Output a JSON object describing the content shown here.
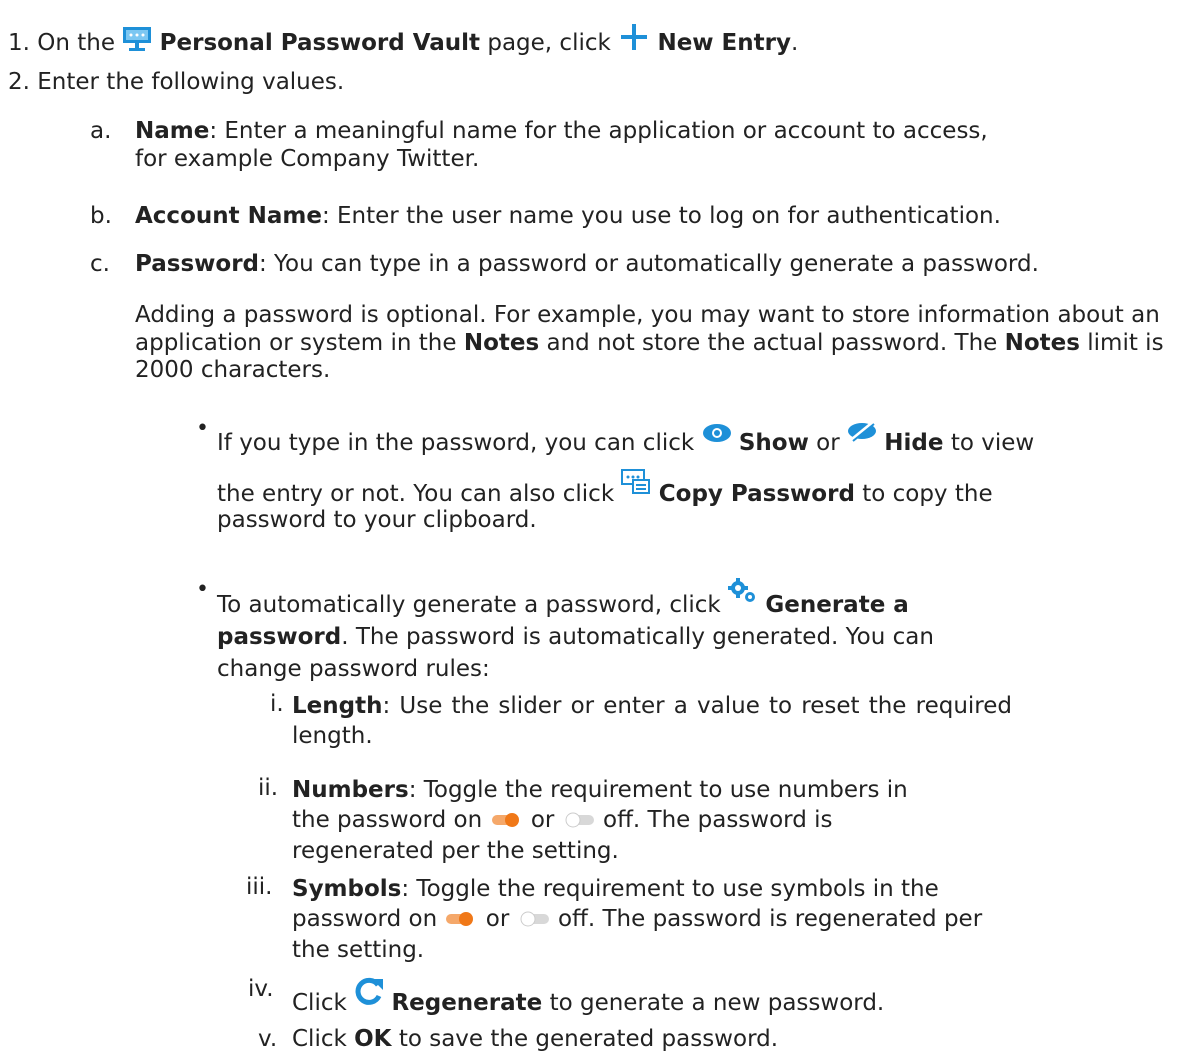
{
  "markers": {
    "s1": "1.",
    "s2": "2.",
    "a": "a.",
    "b": "b.",
    "c": "c.",
    "r1": "i.",
    "r2": "ii.",
    "r3": "iii.",
    "r4": "iv.",
    "r5": "v.",
    "bullet": "•"
  },
  "step1": {
    "t1": "On the",
    "vault": "Personal Password Vault",
    "t2": "page, click",
    "new_entry": "New Entry",
    "t3": "."
  },
  "step2": {
    "text": "Enter the following values."
  },
  "item_a": {
    "label": "Name",
    "text": ": Enter a meaningful name for the application or account to access, for example Company Twitter."
  },
  "item_b": {
    "label": "Account Name",
    "text": ": Enter the user name you use to log on for authentication."
  },
  "item_c": {
    "label": "Password",
    "text": ": You can type in a password or automatically generate a password.",
    "para1": "Adding a password is optional. For example, you may want to store information about an application or system in the",
    "notes1": "Notes",
    "para2": "and not store the actual password. The",
    "notes2": "Notes",
    "para3": "limit is 2000 characters."
  },
  "bullet1": {
    "t1": "If you type in the password, you can click",
    "show": "Show",
    "t2": "or",
    "hide": "Hide",
    "t3": "to view",
    "t4": "the entry or not. You can also click",
    "copy": "Copy Password",
    "t5": "to copy the",
    "t6": "password to your clipboard."
  },
  "bullet2": {
    "t1": "To automatically generate a password, click",
    "gen": "Generate a password",
    "t2": ". The password is automatically generated. You can change password rules:"
  },
  "rule_i": {
    "label": "Length",
    "text": ": Use the slider or enter a value to reset the required length."
  },
  "rule_ii": {
    "label": "Numbers",
    "t1": ": Toggle the requirement to use numbers in the password on",
    "t2": "or",
    "t3": "off. The password is regenerated per the setting."
  },
  "rule_iii": {
    "label": "Symbols",
    "t1": ": Toggle the requirement to use symbols in the password on",
    "t2": "or",
    "t3": "off. The password is regenerated per the setting."
  },
  "rule_iv": {
    "t1": "Click",
    "regen": "Regenerate",
    "t2": "to generate a new password."
  },
  "rule_v": {
    "t1": "Click",
    "ok": "OK",
    "t2": "to save the generated password."
  },
  "colors": {
    "icon_blue": "#1e90d8",
    "toggle_on": "#f07818",
    "toggle_off": "#d8d8d8"
  },
  "icons": [
    "vault-icon",
    "plus-icon",
    "eye-show-icon",
    "eye-hide-icon",
    "copy-password-icon",
    "gears-icon",
    "regenerate-icon",
    "toggle-on-icon",
    "toggle-off-icon"
  ]
}
